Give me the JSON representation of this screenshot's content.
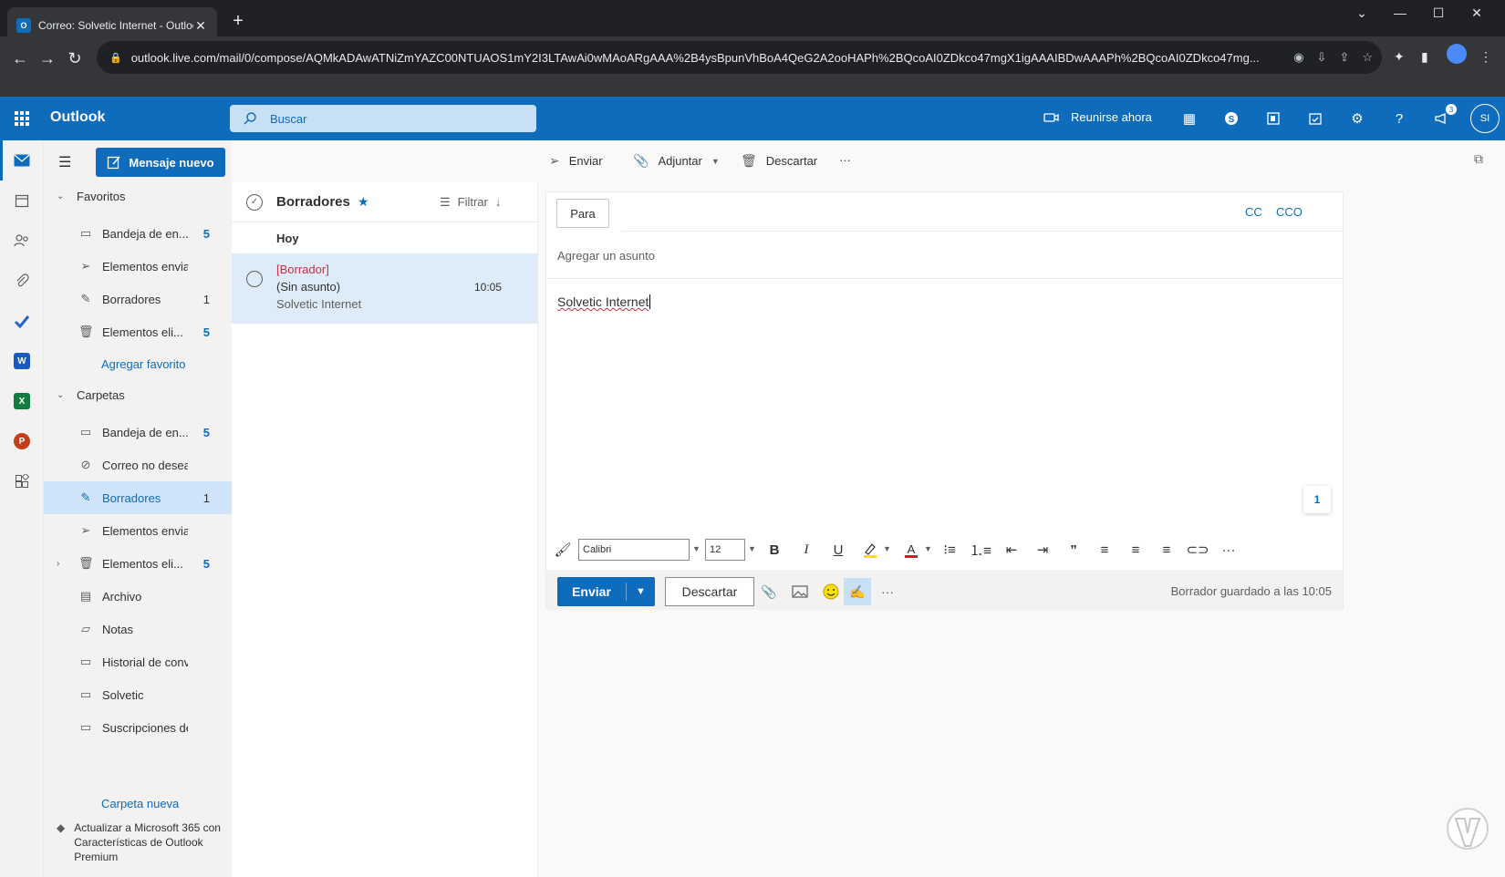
{
  "browser": {
    "tab_title": "Correo: Solvetic Internet - Outlook",
    "favicon_letter": "O",
    "url": "outlook.live.com/mail/0/compose/AQMkADAwATNiZmYAZC00NTUAOS1mY2I3LTAwAi0wMAoARgAAA%2B4ysBpunVhBoA4QeG2A2ooHAPh%2BQcoAI0ZDkco47mgX1igAAAIBDwAAAPh%2BQcoAI0ZDkco47mg...",
    "new_tab": "+",
    "close_tab": "✕",
    "back": "←",
    "forward": "→",
    "reload": "↻",
    "menu": "⋮"
  },
  "header": {
    "app_name": "Outlook",
    "search_placeholder": "Buscar",
    "meet_now": "Reunirse ahora",
    "help": "?",
    "notif_count": "3",
    "avatar_initials": "SI"
  },
  "folder_pane": {
    "new_message": "Mensaje nuevo",
    "favorites_label": "Favoritos",
    "favorites": [
      {
        "name": "Bandeja de en...",
        "count": "5",
        "icon": "inbox-icon"
      },
      {
        "name": "Elementos envia...",
        "count": "",
        "icon": "send-icon"
      },
      {
        "name": "Borradores",
        "count": "1",
        "icon": "pencil-icon"
      },
      {
        "name": "Elementos eli...",
        "count": "5",
        "icon": "trash-icon"
      }
    ],
    "add_favorite": "Agregar favorito",
    "folders_label": "Carpetas",
    "folders": [
      {
        "name": "Bandeja de en...",
        "count": "5"
      },
      {
        "name": "Correo no desea...",
        "count": ""
      },
      {
        "name": "Borradores",
        "count": "1"
      },
      {
        "name": "Elementos envia...",
        "count": ""
      },
      {
        "name": "Elementos eli...",
        "count": "5"
      },
      {
        "name": "Archivo",
        "count": ""
      },
      {
        "name": "Notas",
        "count": ""
      },
      {
        "name": "Historial de conv...",
        "count": ""
      },
      {
        "name": "Solvetic",
        "count": ""
      },
      {
        "name": "Suscripciones de...",
        "count": ""
      }
    ],
    "new_folder": "Carpeta nueva",
    "upgrade_text": "Actualizar a Microsoft 365 con Características de Outlook Premium"
  },
  "message_list": {
    "title": "Borradores",
    "filter": "Filtrar",
    "group": "Hoy",
    "messages": [
      {
        "tag": "[Borrador]",
        "subject": "(Sin asunto)",
        "from": "Solvetic Internet",
        "time": "10:05"
      }
    ]
  },
  "commands": {
    "send": "Enviar",
    "attach": "Adjuntar",
    "discard": "Descartar",
    "more": "···"
  },
  "compose": {
    "to_label": "Para",
    "cc": "CC",
    "bcc": "CCO",
    "subject_placeholder": "Agregar un asunto",
    "body": "Solvetic Internet",
    "page_badge": "1",
    "font": "Calibri",
    "size": "12",
    "bold": "B",
    "italic": "I",
    "underline": "U",
    "quote": "”",
    "send": "Enviar",
    "discard": "Descartar",
    "saved_status": "Borrador guardado a las 10:05"
  },
  "colors": {
    "brand": "#0f6cbd",
    "selected_bg": "#cfe4fa",
    "draft_red": "#c4314b"
  }
}
